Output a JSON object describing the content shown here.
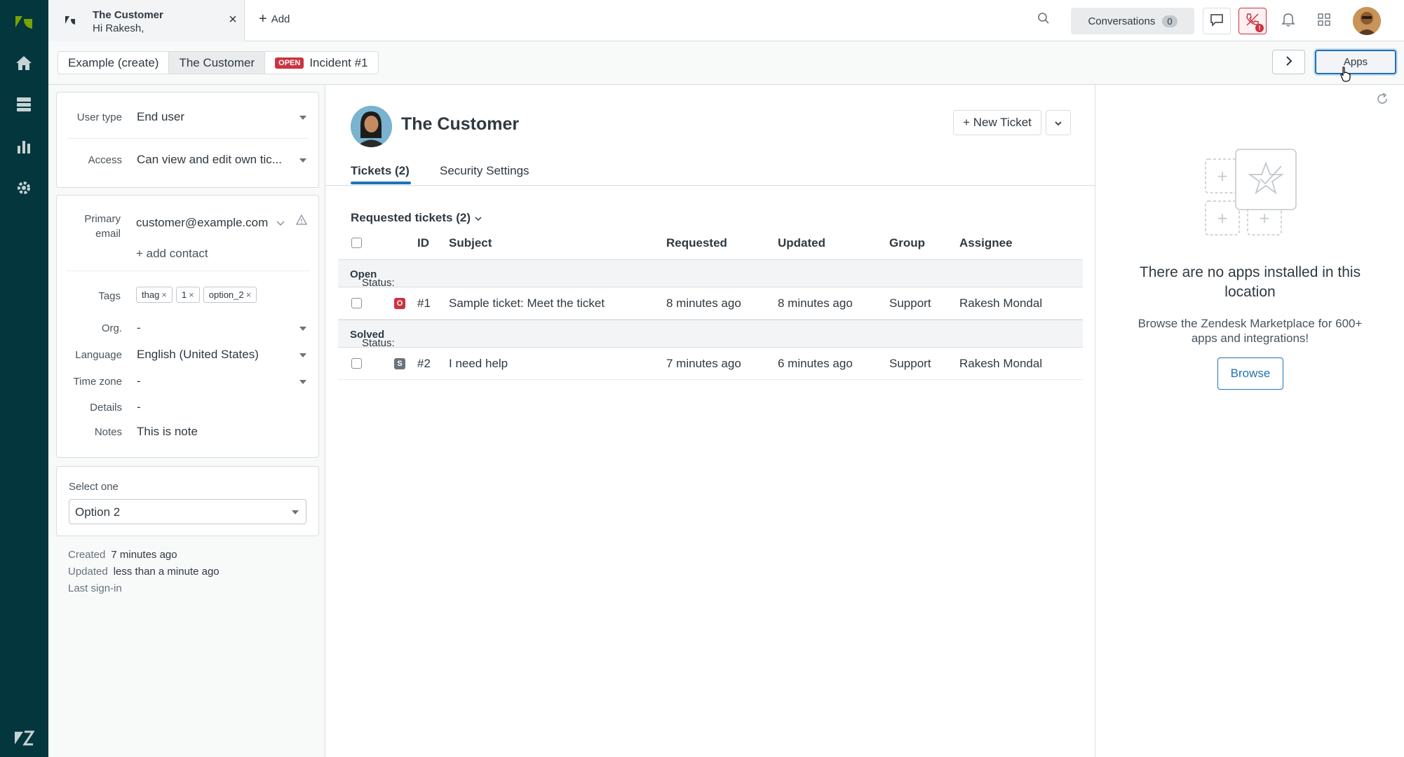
{
  "rail": {
    "icons": [
      "zendesk-logo-icon",
      "home-icon",
      "views-icon",
      "reporting-icon",
      "admin-icon",
      "zendesk-bottom-logo-icon"
    ]
  },
  "topbar": {
    "tab_title": "The Customer",
    "tab_subtitle": "Hi Rakesh,",
    "add_label": "Add",
    "conversations_label": "Conversations",
    "conversations_count": "0",
    "phone_alert": "!"
  },
  "subbar": {
    "crumbs": [
      "Example (create)",
      "The Customer",
      "Incident #1"
    ],
    "open_badge": "OPEN",
    "apps_label": "Apps"
  },
  "user_fields": {
    "user_type_label": "User type",
    "user_type_value": "End user",
    "access_label": "Access",
    "access_value": "Can view and edit own tic...",
    "primary_email_label_1": "Primary",
    "primary_email_label_2": "email",
    "primary_email_value": "customer@example.com",
    "add_contact": "+ add contact",
    "tags_label": "Tags",
    "tags": [
      "thag",
      "1",
      "option_2"
    ],
    "org_label": "Org.",
    "org_value": "-",
    "language_label": "Language",
    "language_value": "English (United States)",
    "timezone_label": "Time zone",
    "timezone_value": "-",
    "details_label": "Details",
    "details_value": "-",
    "notes_label": "Notes",
    "notes_value": "This is note",
    "select_one_label": "Select one",
    "select_one_value": "Option 2",
    "created_label": "Created",
    "created_value": "7 minutes ago",
    "updated_label": "Updated",
    "updated_value": "less than a minute ago",
    "last_signin_label": "Last sign-in"
  },
  "main": {
    "customer_name": "The Customer",
    "new_ticket_label": "+ New Ticket",
    "tabs": [
      "Tickets (2)",
      "Security Settings"
    ],
    "requested_heading": "Requested tickets (2)",
    "columns": [
      "ID",
      "Subject",
      "Requested",
      "Updated",
      "Group",
      "Assignee"
    ],
    "groups": [
      {
        "status_prefix": "Status:",
        "status": "Open",
        "rows": [
          {
            "badge": "O",
            "badge_color": "#cc3340",
            "id": "#1",
            "subject": "Sample ticket: Meet the ticket",
            "requested": "8 minutes ago",
            "updated": "8 minutes ago",
            "group": "Support",
            "assignee": "Rakesh Mondal"
          }
        ]
      },
      {
        "status_prefix": "Status:",
        "status": "Solved",
        "rows": [
          {
            "badge": "S",
            "badge_color": "#68737d",
            "id": "#2",
            "subject": "I need help",
            "requested": "7 minutes ago",
            "updated": "6 minutes ago",
            "group": "Support",
            "assignee": "Rakesh Mondal"
          }
        ]
      }
    ]
  },
  "apps_panel": {
    "title": "There are no apps installed in this location",
    "subtitle": "Browse the Zendesk Marketplace for 600+ apps and integrations!",
    "browse_label": "Browse"
  },
  "colors": {
    "rail": "#03363d",
    "accent": "#1f73b7",
    "danger": "#cc3340"
  }
}
